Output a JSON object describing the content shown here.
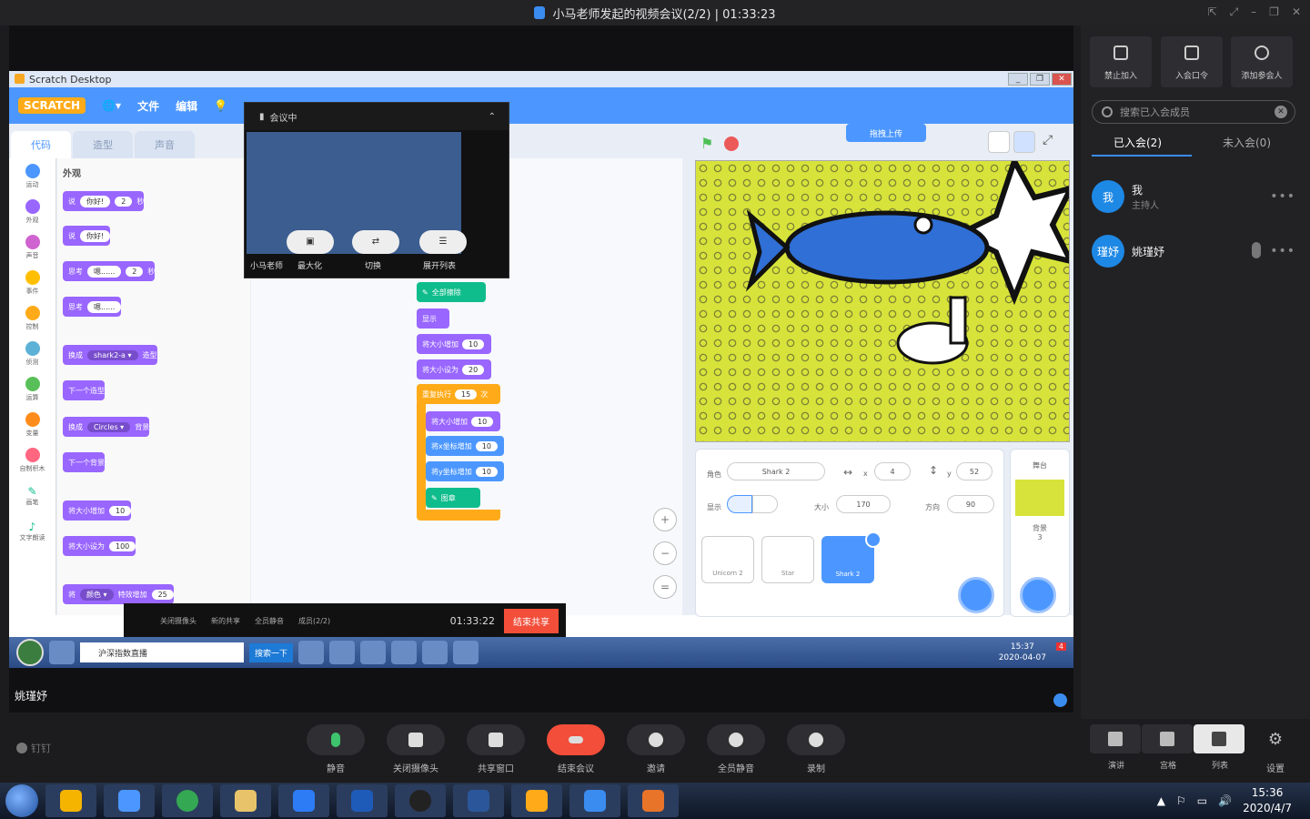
{
  "window": {
    "title": "小马老师发起的视频会议(2/2) | 01:33:23"
  },
  "scratch": {
    "app_title": "Scratch Desktop",
    "logo": "SCRATCH",
    "menu": [
      "文件",
      "编辑"
    ],
    "tabs": [
      "代码",
      "造型",
      "声音"
    ],
    "categories": [
      "运动",
      "外观",
      "声音",
      "事件",
      "控制",
      "侦测",
      "运算",
      "变量",
      "自制积木",
      "画笔",
      "文字朗读"
    ],
    "palette_title": "外观",
    "palette_blocks": [
      {
        "text": "说",
        "arg": "你好!",
        "num": "2",
        "suffix": "秒"
      },
      {
        "text": "说",
        "arg": "你好!"
      },
      {
        "text": "思考",
        "arg": "嗯......",
        "num": "2",
        "suffix": "秒"
      },
      {
        "text": "思考",
        "arg": "嗯......"
      },
      {
        "text": "换成",
        "arg": "shark2-a ▾",
        "suffix": "造型"
      },
      {
        "text": "下一个造型"
      },
      {
        "text": "换成",
        "arg": "Circles ▾",
        "suffix": "背景"
      },
      {
        "text": "下一个背景"
      },
      {
        "text": "将大小增加",
        "num": "10"
      },
      {
        "text": "将大小设为",
        "num": "100"
      },
      {
        "text": "将",
        "arg": "颜色 ▾",
        "suffix": "特效增加",
        "num": "25"
      }
    ],
    "script_blocks": [
      {
        "text": "全部擦除"
      },
      {
        "text": "显示"
      },
      {
        "text": "将大小增加",
        "num": "10"
      },
      {
        "text": "将大小设为",
        "num": "20"
      },
      {
        "text": "重复执行",
        "num": "15",
        "suffix": "次"
      },
      {
        "text": "将大小增加",
        "num": "10"
      },
      {
        "text": "将x坐标增加",
        "num": "10"
      },
      {
        "text": "将y坐标增加",
        "num": "10"
      },
      {
        "text": "图章"
      }
    ],
    "upload_btn": "拖拽上传",
    "sprite_panel": {
      "sprite_label": "角色",
      "sprite_name": "Shark 2",
      "x_label": "x",
      "x_value": "4",
      "y_label": "y",
      "y_value": "52",
      "show_label": "显示",
      "size_label": "大小",
      "size_value": "170",
      "direction_label": "方向",
      "direction_value": "90",
      "sprites": [
        "Unicorn 2",
        "Star",
        "Shark 2"
      ]
    },
    "backdrop_panel": {
      "title": "舞台",
      "label": "背景",
      "count": "3"
    }
  },
  "meeting_mini": {
    "status": "会议中",
    "presenter": "小马老师",
    "buttons": [
      "最大化",
      "切换",
      "展开列表"
    ]
  },
  "share_toolbar": {
    "items": [
      "关闭摄像头",
      "新的共享",
      "全员静音",
      "成员(2/2)"
    ],
    "time": "01:33:22",
    "end_label": "结束共享"
  },
  "xp_taskbar": {
    "search_text": "沪深指数直播",
    "search_btn": "搜索一下",
    "clock_time": "15:37",
    "clock_date": "2020-04-07",
    "badge": "4"
  },
  "caption": "姚瑾妤",
  "right_panel": {
    "buttons": [
      "禁止加入",
      "入会口令",
      "添加参会人"
    ],
    "search_placeholder": "搜索已入会成员",
    "tab_joined": "已入会(2)",
    "tab_not_joined": "未入会(0)",
    "members": [
      {
        "avatar": "我",
        "name": "我",
        "role": "主持人"
      },
      {
        "avatar": "瑾妤",
        "name": "姚瑾妤",
        "role": ""
      }
    ]
  },
  "controls": {
    "brand": "钉钉",
    "buttons": [
      "静音",
      "关闭摄像头",
      "共享窗口",
      "结束会议",
      "邀请",
      "全员静音",
      "录制"
    ],
    "views": [
      "演讲",
      "宫格",
      "列表"
    ],
    "settings": "设置"
  },
  "win_taskbar": {
    "time": "15:36",
    "date": "2020/4/7"
  },
  "colors": {
    "scratch_blue": "#4c97ff",
    "looks_purple": "#9966ff",
    "end_red": "#f24e3a",
    "accent": "#3b8cf0"
  }
}
